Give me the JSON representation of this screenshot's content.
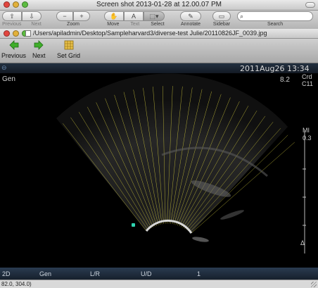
{
  "app_window": {
    "title": "Screen shot 2013-01-28 at 12.00.07 PM",
    "toolbar": {
      "previous_label": "Previous",
      "next_label": "Next",
      "zoom_label": "Zoom",
      "move_label": "Move",
      "text_label": "Text",
      "select_label": "Select",
      "annotate_label": "Annotate",
      "sidebar_label": "Sidebar",
      "search_label": "Search",
      "search_placeholder": "Q"
    }
  },
  "image_window": {
    "path": "/Users/apiladmin/Desktop/Sampleharvard3/diverse-test Julie/20110826JF_0039.jpg",
    "toolbar": {
      "previous_label": "Previous",
      "next_label": "Next",
      "set_grid_label": "Set Grid"
    }
  },
  "ultrasound": {
    "date_time": "2011Aug26 13:34",
    "mode_left": "Gen",
    "right_value": "8.2",
    "right_label_1": "Crd",
    "right_label_2": "C11",
    "mi_label": "MI",
    "mi_value": "0.3",
    "delta_label": "Δ",
    "bottom_bar": {
      "mode": "2D",
      "gen": "Gen",
      "lr": "L/R",
      "ud": "U/D",
      "number": "1"
    }
  },
  "status": {
    "coords": "82.0, 304.0)"
  }
}
